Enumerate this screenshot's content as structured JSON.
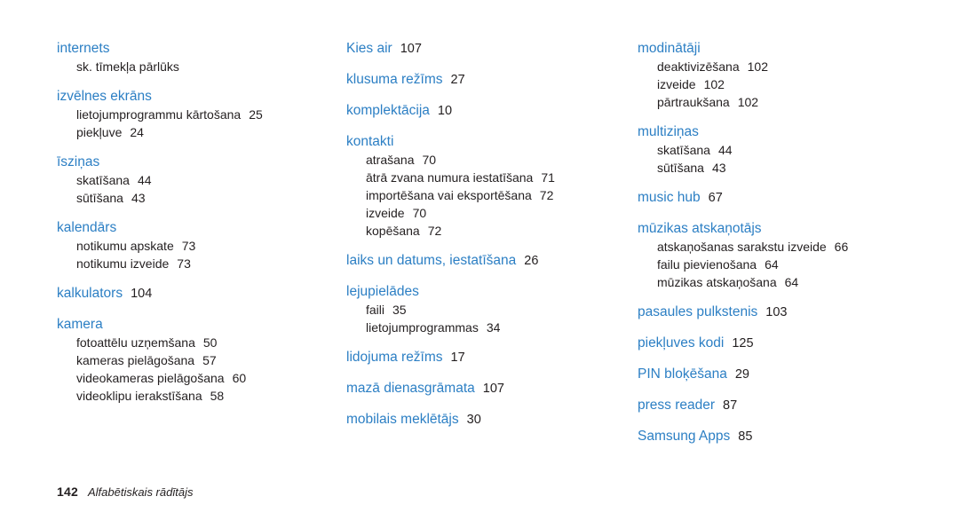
{
  "document": {
    "footer": {
      "page_number": "142",
      "section_label": "Alfabētiskais rādītājs"
    },
    "columns": [
      {
        "entries": [
          {
            "type": "head",
            "label": "internets",
            "page": ""
          },
          {
            "type": "note",
            "label": "sk. tīmekļa pārlūks"
          },
          {
            "type": "head",
            "label": "izvēlnes ekrāns",
            "page": ""
          },
          {
            "type": "sub",
            "label": "lietojumprogrammu kārtošana",
            "page": "25"
          },
          {
            "type": "sub",
            "label": "piekļuve",
            "page": "24"
          },
          {
            "type": "head",
            "label": "īsziņas",
            "page": ""
          },
          {
            "type": "sub",
            "label": "skatīšana",
            "page": "44"
          },
          {
            "type": "sub",
            "label": "sūtīšana",
            "page": "43"
          },
          {
            "type": "head",
            "label": "kalendārs",
            "page": ""
          },
          {
            "type": "sub",
            "label": "notikumu apskate",
            "page": "73"
          },
          {
            "type": "sub",
            "label": "notikumu izveide",
            "page": "73"
          },
          {
            "type": "head",
            "label": "kalkulators",
            "page": "104"
          },
          {
            "type": "head",
            "label": "kamera",
            "page": ""
          },
          {
            "type": "sub",
            "label": "fotoattēlu uzņemšana",
            "page": "50"
          },
          {
            "type": "sub",
            "label": "kameras pielāgošana",
            "page": "57"
          },
          {
            "type": "sub",
            "label": "videokameras pielāgošana",
            "page": "60"
          },
          {
            "type": "sub",
            "label": "videoklipu ierakstīšana",
            "page": "58"
          }
        ]
      },
      {
        "entries": [
          {
            "type": "head",
            "label": "Kies air",
            "page": "107"
          },
          {
            "type": "head",
            "label": "klusuma režīms",
            "page": "27"
          },
          {
            "type": "head",
            "label": "komplektācija",
            "page": "10"
          },
          {
            "type": "head",
            "label": "kontakti",
            "page": ""
          },
          {
            "type": "sub",
            "label": "atrašana",
            "page": "70"
          },
          {
            "type": "sub",
            "label": "ātrā zvana numura iestatīšana",
            "page": "71"
          },
          {
            "type": "sub",
            "label": "importēšana vai eksportēšana",
            "page": "72"
          },
          {
            "type": "sub",
            "label": "izveide",
            "page": "70"
          },
          {
            "type": "sub",
            "label": "kopēšana",
            "page": "72"
          },
          {
            "type": "head",
            "label": "laiks un datums, iestatīšana",
            "page": "26"
          },
          {
            "type": "head",
            "label": "lejupielādes",
            "page": ""
          },
          {
            "type": "sub",
            "label": "faili",
            "page": "35"
          },
          {
            "type": "sub",
            "label": "lietojumprogrammas",
            "page": "34"
          },
          {
            "type": "head",
            "label": "lidojuma režīms",
            "page": "17"
          },
          {
            "type": "head",
            "label": "mazā dienasgrāmata",
            "page": "107"
          },
          {
            "type": "head",
            "label": "mobilais meklētājs",
            "page": "30"
          }
        ]
      },
      {
        "entries": [
          {
            "type": "head",
            "label": "modinātāji",
            "page": ""
          },
          {
            "type": "sub",
            "label": "deaktivizēšana",
            "page": "102"
          },
          {
            "type": "sub",
            "label": "izveide",
            "page": "102"
          },
          {
            "type": "sub",
            "label": "pārtraukšana",
            "page": "102"
          },
          {
            "type": "head",
            "label": "multiziņas",
            "page": ""
          },
          {
            "type": "sub",
            "label": "skatīšana",
            "page": "44"
          },
          {
            "type": "sub",
            "label": "sūtīšana",
            "page": "43"
          },
          {
            "type": "head",
            "label": "music hub",
            "page": "67"
          },
          {
            "type": "head",
            "label": "mūzikas atskaņotājs",
            "page": ""
          },
          {
            "type": "sub",
            "label": "atskaņošanas sarakstu izveide",
            "page": "66"
          },
          {
            "type": "sub",
            "label": "failu pievienošana",
            "page": "64"
          },
          {
            "type": "sub",
            "label": "mūzikas atskaņošana",
            "page": "64"
          },
          {
            "type": "head",
            "label": "pasaules pulkstenis",
            "page": "103"
          },
          {
            "type": "head",
            "label": "piekļuves kodi",
            "page": "125"
          },
          {
            "type": "head",
            "label": "PIN bloķēšana",
            "page": "29"
          },
          {
            "type": "head",
            "label": "press reader",
            "page": "87"
          },
          {
            "type": "head",
            "label": "Samsung Apps",
            "page": "85"
          }
        ]
      }
    ]
  },
  "colors": {
    "heading": "#2c7fc4",
    "body": "#231f20"
  }
}
